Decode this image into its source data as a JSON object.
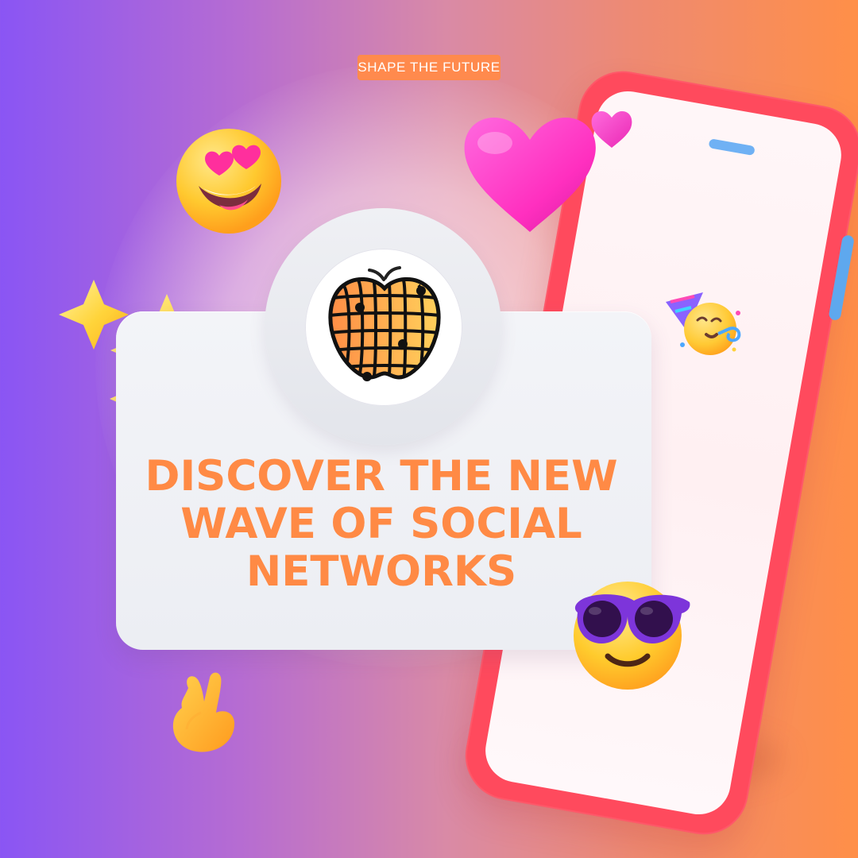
{
  "header": {
    "tagline": "SHAPE THE FUTURE"
  },
  "main": {
    "headline_lines": [
      "DISCOVER THE NEW",
      "WAVE OF SOCIAL",
      "NETWORKS"
    ]
  },
  "colors": {
    "accent": "#ff8a45",
    "background_left": "#8a55f4",
    "background_right": "#ff8f48",
    "phone": "#ff4a5d",
    "card": "#eceef3"
  },
  "icons": {
    "logo": "apple-grid-logo-icon",
    "heart_eyes": "heart-eyes-emoji-icon",
    "hearts": "heart-icon",
    "sparkles": "sparkles-icon",
    "party": "party-face-emoji-icon",
    "cool": "sunglasses-emoji-icon",
    "peace": "victory-hand-emoji-icon"
  }
}
